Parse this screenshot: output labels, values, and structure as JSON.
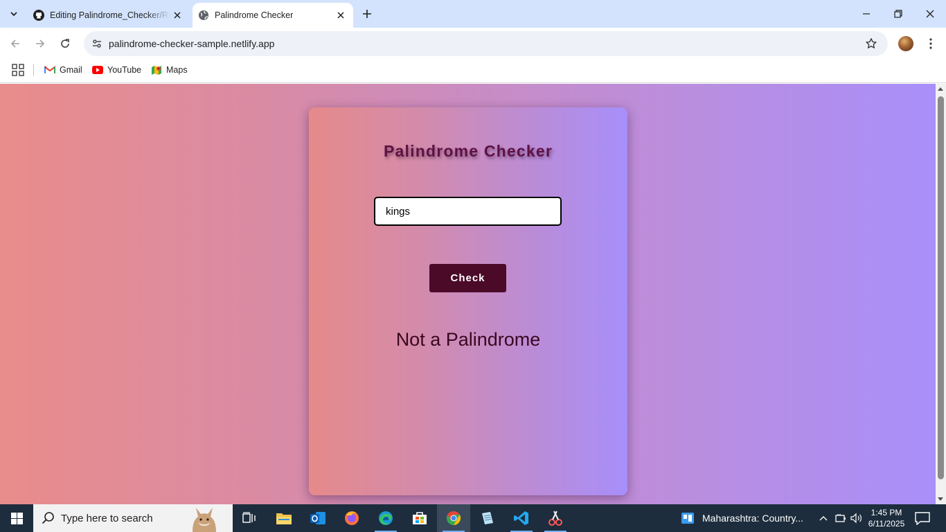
{
  "browser": {
    "tabs": [
      {
        "title": "Editing Palindrome_Checker/README.md",
        "favicon": "github-icon",
        "active": false
      },
      {
        "title": "Palindrome Checker",
        "favicon": "globe-icon",
        "active": true
      }
    ],
    "url": "palindrome-checker-sample.netlify.app",
    "bookmarks": [
      {
        "label": "Gmail",
        "icon": "gmail-icon"
      },
      {
        "label": "YouTube",
        "icon": "youtube-icon"
      },
      {
        "label": "Maps",
        "icon": "maps-icon"
      }
    ]
  },
  "page": {
    "title": "Palindrome Checker",
    "input_value": "kings",
    "button_label": "Check",
    "result_text": "Not a Palindrome",
    "colors": {
      "title": "#5e1144",
      "button_bg": "#4b0a28",
      "result": "#3a0720",
      "gradient_start": "#e98c8b",
      "gradient_end": "#a98ffa"
    }
  },
  "taskbar": {
    "search_placeholder": "Type here to search",
    "weather_text": "Maharashtra: Country...",
    "time": "1:45 PM",
    "date": "6/11/2025",
    "pinned_apps": [
      "task-view-icon",
      "file-explorer-icon",
      "outlook-icon",
      "firefox-icon",
      "edge-icon",
      "store-icon",
      "chrome-icon",
      "notepad-icon",
      "vscode-icon",
      "snipping-tool-icon"
    ]
  }
}
